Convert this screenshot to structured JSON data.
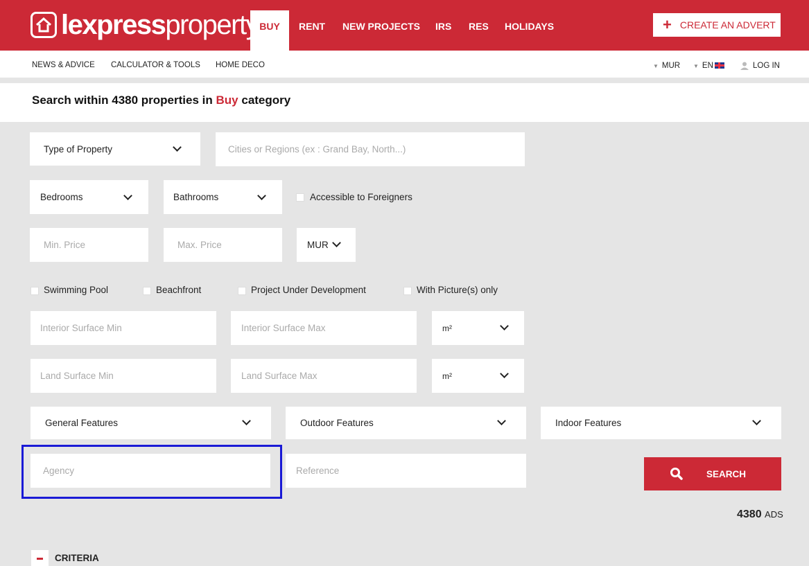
{
  "brand": {
    "logo_bold": "lexpress",
    "logo_light": "property"
  },
  "nav": {
    "items": [
      {
        "label": "BUY",
        "active": true
      },
      {
        "label": "RENT"
      },
      {
        "label": "NEW PROJECTS"
      },
      {
        "label": "IRS"
      },
      {
        "label": "RES"
      },
      {
        "label": "HOLIDAYS"
      }
    ],
    "create_advert": "CREATE AN ADVERT",
    "create_plus": "+"
  },
  "subnav": {
    "links": [
      "NEWS & ADVICE",
      "CALCULATOR & TOOLS",
      "HOME DECO"
    ],
    "currency": "MUR",
    "language": "EN",
    "login": "LOG IN"
  },
  "heading": {
    "prefix": "Search within 4380 properties in",
    "category": "Buy",
    "suffix": "category"
  },
  "form": {
    "type_of_property": "Type of Property",
    "location_placeholder": "Cities or Regions (ex : Grand Bay, North...)",
    "bedrooms": "Bedrooms",
    "bathrooms": "Bathrooms",
    "accessible_foreigners": "Accessible to Foreigners",
    "min_price": "Min. Price",
    "max_price": "Max. Price",
    "price_currency": "MUR",
    "swimming_pool": "Swimming Pool",
    "beachfront": "Beachfront",
    "project_dev": "Project Under Development",
    "with_pictures": "With Picture(s) only",
    "interior_min": "Interior Surface Min",
    "interior_max": "Interior Surface Max",
    "interior_unit": "m²",
    "land_min": "Land Surface Min",
    "land_max": "Land Surface Max",
    "land_unit": "m²",
    "general_features": "General Features",
    "outdoor_features": "Outdoor Features",
    "indoor_features": "Indoor Features",
    "agency": "Agency",
    "reference": "Reference",
    "search": "SEARCH"
  },
  "results": {
    "count": "4380",
    "unit": "ADS"
  },
  "criteria": {
    "label": "CRITERIA"
  },
  "colors": {
    "brand_red": "#cc2936",
    "highlight_blue": "#1a1ad6"
  }
}
